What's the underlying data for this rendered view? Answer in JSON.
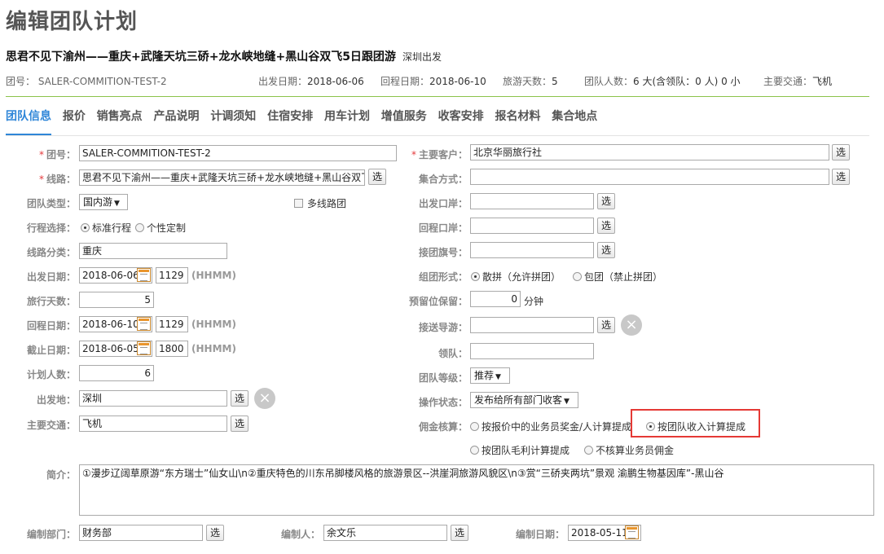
{
  "page_title": "编辑团队计划",
  "route_title": "思君不见下渝州——重庆+武隆天坑三硚+龙水峡地缝+黑山谷双飞5日跟团游",
  "departure_city_tag": "深圳出发",
  "info": {
    "team_no": "团号： SALER-COMMITION-TEST-2",
    "depart_date": "出发日期：",
    "depart_date_val": "2018-06-06",
    "return_date": "回程日期：",
    "return_date_val": "2018-06-10",
    "days": "旅游天数：",
    "days_val": "5",
    "people": "团队人数：",
    "people_val": "6 大(含领队：0 人) 0 小",
    "transport": "主要交通：",
    "transport_val": "飞机"
  },
  "tabs": [
    "团队信息",
    "报价",
    "销售亮点",
    "产品说明",
    "计调须知",
    "住宿安排",
    "用车计划",
    "增值服务",
    "收客安排",
    "报名材料",
    "集合地点"
  ],
  "form": {
    "team_no_label": "团号：",
    "team_no_value": "SALER-COMMITION-TEST-2",
    "route_label": "线路：",
    "route_value": "思君不见下渝州——重庆+武隆天坑三硚+龙水峡地缝+黑山谷双飞",
    "team_type_label": "团队类型：",
    "team_type_value": "国内游",
    "multi_route_label": "多线路团",
    "itinerary_label": "行程选择：",
    "itinerary_opt1": "标准行程",
    "itinerary_opt2": "个性定制",
    "route_cat_label": "线路分类：",
    "route_cat_value": "重庆",
    "depart_date_label": "出发日期：",
    "depart_date_value": "2018-06-06",
    "depart_time_value": "1129",
    "hhmm": "(HHMM)",
    "days_label": "旅行天数：",
    "days_value": "5",
    "return_date_label": "回程日期：",
    "return_date_value": "2018-06-10",
    "return_time_value": "1129",
    "deadline_label": "截止日期：",
    "deadline_value": "2018-06-05",
    "deadline_time_value": "1800",
    "plan_people_label": "计划人数：",
    "plan_people_value": "6",
    "origin_label": "出发地：",
    "origin_value": "深圳",
    "main_transport_label": "主要交通：",
    "main_transport_value": "飞机",
    "customer_label": "主要客户：",
    "customer_value": "北京华丽旅行社",
    "gather_label": "集合方式：",
    "gather_value": "",
    "depart_port_label": "出发口岸：",
    "return_port_label": "回程口岸：",
    "flag_label": "接团旗号：",
    "group_form_label": "组团形式：",
    "group_form_opt1": "散拼（允许拼团）",
    "group_form_opt2": "包团（禁止拼团）",
    "reserve_label": "预留位保留：",
    "reserve_value": "0",
    "reserve_unit": "分钟",
    "guide_label": "接送导游：",
    "leader_label": "领队：",
    "level_label": "团队等级：",
    "level_value": "推荐",
    "op_status_label": "操作状态：",
    "op_status_value": "发布给所有部门收客",
    "commission_label": "佣金核算：",
    "commission_opt1": "按报价中的业务员奖金/人计算提成",
    "commission_opt2": "按团队收入计算提成",
    "commission_opt3": "按团队毛利计算提成",
    "commission_opt4": "不核算业务员佣金",
    "intro_label": "简介：",
    "intro_value": "①漫步辽阔草原游“东方瑞士”仙女山\\n②重庆特色的川东吊脚楼风格的旅游景区--洪崖洞旅游风貌区\\n③赏“三硚夹两坑”景观 渝鹏生物基因库”-黑山谷",
    "dept_label": "编制部门：",
    "dept_value": "财务部",
    "author_label": "编制人：",
    "author_value": "余文乐",
    "make_date_label": "编制日期：",
    "make_date_value": "2018-05-11",
    "select_btn": "选",
    "clear_icon_char": "×"
  }
}
